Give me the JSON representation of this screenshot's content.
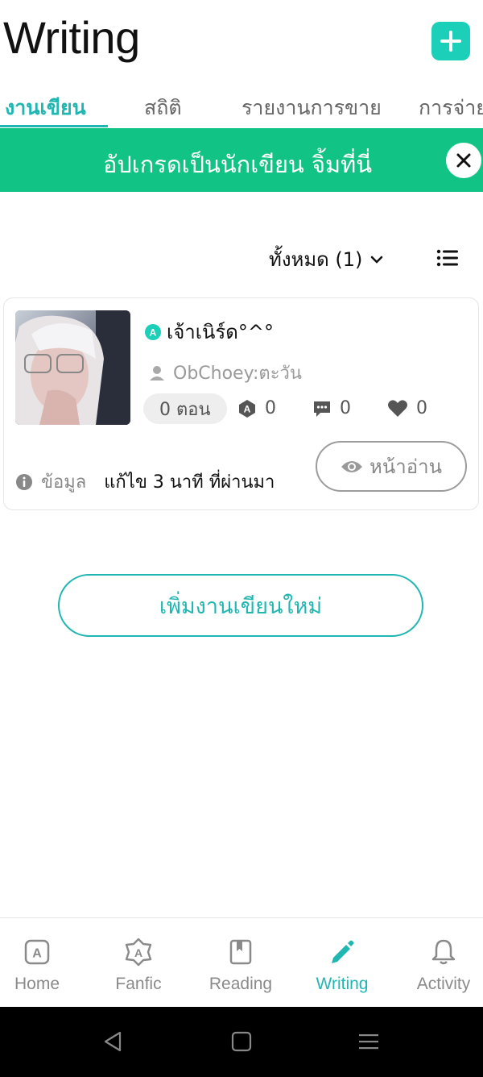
{
  "header": {
    "title": "Writing",
    "add_icon": "plus-icon"
  },
  "tabs": [
    {
      "label": "งานเขียน",
      "active": true
    },
    {
      "label": "สถิติ",
      "active": false
    },
    {
      "label": "รายงานการขาย",
      "active": false
    },
    {
      "label": "การจ่าย",
      "active": false
    }
  ],
  "banner": {
    "text": "อัปเกรดเป็นนักเขียน จิ้มที่นี่",
    "close_icon": "close-icon",
    "color": "#12c386"
  },
  "filter": {
    "label": "ทั้งหมด (1)",
    "list_icon": "list-icon"
  },
  "story": {
    "title": "เจ้าเนิร์ด°^°",
    "author": "ObChoey:ตะวัน",
    "episodes": "0 ตอน",
    "fanfic_count": "0",
    "comment_count": "0",
    "like_count": "0",
    "info_label": "ข้อมูล",
    "edited": "แก้ไข 3 นาที ที่ผ่านมา",
    "read_button": "หน้าอ่าน"
  },
  "add_writing_button": "เพิ่มงานเขียนใหม่",
  "nav": {
    "home": "Home",
    "fanfic": "Fanfic",
    "reading": "Reading",
    "writing": "Writing",
    "activity": "Activity"
  },
  "colors": {
    "accent": "#20b6b2",
    "add_button": "#1ccfb9"
  }
}
